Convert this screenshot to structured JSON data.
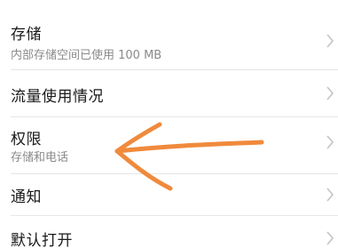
{
  "settings": {
    "items": [
      {
        "title": "存储",
        "subtitle": "内部存储空间已使用 100 MB",
        "chevron_icon": "chevron-right-icon"
      },
      {
        "title": "流量使用情况",
        "subtitle": "",
        "chevron_icon": "chevron-right-icon"
      },
      {
        "title": "权限",
        "subtitle": "存储和电话",
        "chevron_icon": "chevron-right-icon"
      },
      {
        "title": "通知",
        "subtitle": "",
        "chevron_icon": "chevron-right-icon"
      },
      {
        "title": "默认打开",
        "subtitle": "",
        "chevron_icon": "chevron-right-icon"
      }
    ]
  },
  "annotation": {
    "type": "hand-drawn-arrow",
    "color": "#f08a3c",
    "points_to": "权限"
  },
  "colors": {
    "background": "#ffffff",
    "title_text": "#1a1a1a",
    "subtitle_text": "#8a8a8a",
    "divider": "#e6e6e6",
    "chevron": "#c4c4c4"
  }
}
